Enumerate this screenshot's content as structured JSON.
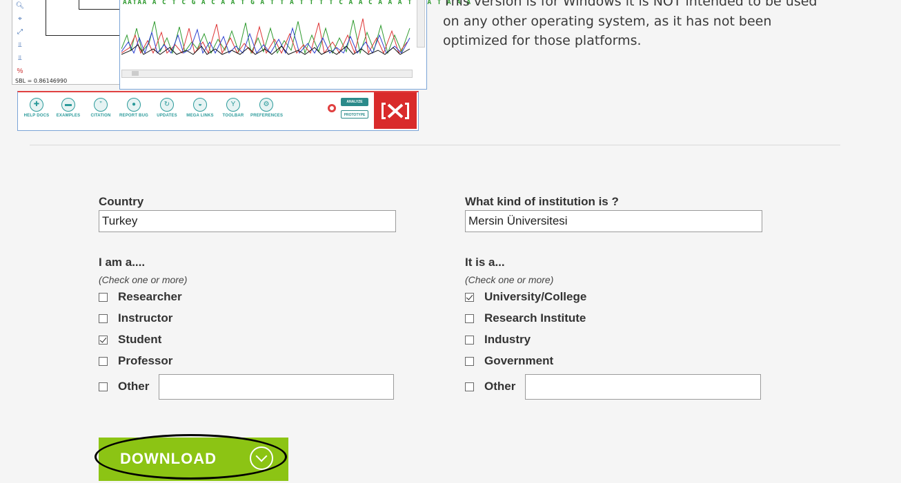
{
  "screenshot": {
    "sbl_text": "SBL = 0.86146990",
    "sequence": "AATAA A C T C G A C A A T G A T T A T T T T C A A C A A A T C A T A A A",
    "tree_tool_icons": [
      "zoom-icon",
      "fit-icon",
      "resize-icon",
      "tree-icon",
      "tree-icon",
      "percent-icon"
    ],
    "toolbar": [
      {
        "label": "HELP DOCS",
        "icon": "help-icon"
      },
      {
        "label": "EXAMPLES",
        "icon": "folder-icon"
      },
      {
        "label": "CITATION",
        "icon": "quote-icon"
      },
      {
        "label": "REPORT BUG",
        "icon": "bug-icon"
      },
      {
        "label": "UPDATES",
        "icon": "updates-icon"
      },
      {
        "label": "MEGA LINKS",
        "icon": "globe-icon"
      },
      {
        "label": "TOOLBAR",
        "icon": "wrench-icon"
      },
      {
        "label": "PREFERENCES",
        "icon": "gear-icon"
      }
    ],
    "analyze_label": "ANALYZE",
    "prototype_label": "PROTOTYPE",
    "logo_text": "|X|"
  },
  "description": "This version is for Windows it is NOT intended to be used on any other operating system, as it has not been optimized for those platforms.",
  "form": {
    "country": {
      "label": "Country",
      "value": "Turkey"
    },
    "institution": {
      "label": "What kind of institution is ?",
      "value": "Mersin Üniversitesi"
    },
    "role": {
      "label": "I am a....",
      "hint": "(Check one or more)",
      "options": [
        {
          "label": "Researcher",
          "checked": false
        },
        {
          "label": "Instructor",
          "checked": false
        },
        {
          "label": "Student",
          "checked": true
        },
        {
          "label": "Professor",
          "checked": false
        },
        {
          "label": "Other",
          "checked": false
        }
      ],
      "other_value": ""
    },
    "type": {
      "label": "It is a...",
      "hint": "(Check one or more)",
      "options": [
        {
          "label": "University/College",
          "checked": true
        },
        {
          "label": "Research Institute",
          "checked": false
        },
        {
          "label": "Industry",
          "checked": false
        },
        {
          "label": "Government",
          "checked": false
        },
        {
          "label": "Other",
          "checked": false
        }
      ],
      "other_value": ""
    }
  },
  "download": {
    "label": "DOWNLOAD",
    "icon": "chevron-down-icon",
    "color": "#8cc414"
  }
}
